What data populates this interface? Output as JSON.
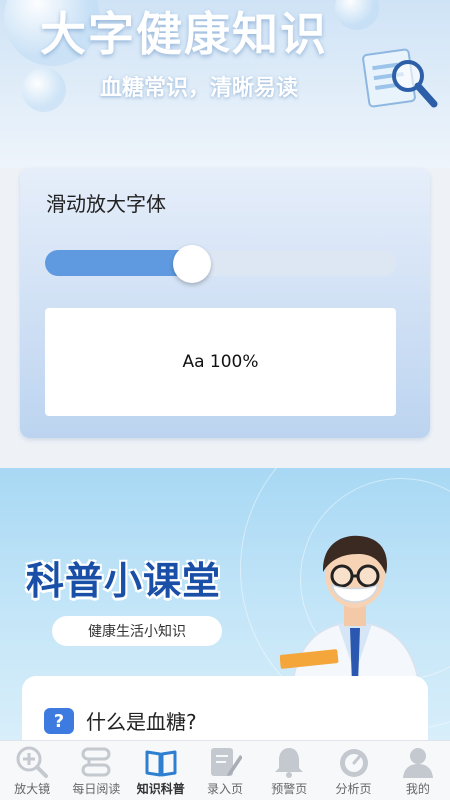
{
  "header": {
    "title": "大字健康知识",
    "subtitle": "血糖常识，清晰易读"
  },
  "font_slider": {
    "title": "滑动放大字体",
    "level_fraction": 0.42,
    "preview_text": "Aa 100%"
  },
  "knowledge": {
    "banner_title": "科普小课堂",
    "pill_text": "健康生活小知识",
    "faq": {
      "icon_glyph": "?",
      "question": "什么是血糖?"
    }
  },
  "tabbar": {
    "items": [
      {
        "label": "放大镜",
        "icon": "magnifier-icon",
        "active": false
      },
      {
        "label": "每日阅读",
        "icon": "daily-reading-icon",
        "active": false
      },
      {
        "label": "知识科普",
        "icon": "book-icon",
        "active": true
      },
      {
        "label": "录入页",
        "icon": "edit-document-icon",
        "active": false
      },
      {
        "label": "预警页",
        "icon": "bell-icon",
        "active": false
      },
      {
        "label": "分析页",
        "icon": "gauge-icon",
        "active": false
      },
      {
        "label": "我的",
        "icon": "user-icon",
        "active": false
      }
    ]
  },
  "colors": {
    "accent": "#5f9ae0",
    "active_tab_icon": "#2f7fd1",
    "inactive_tab_icon": "#c4c8cf",
    "banner_title": "#1a4fa8"
  }
}
